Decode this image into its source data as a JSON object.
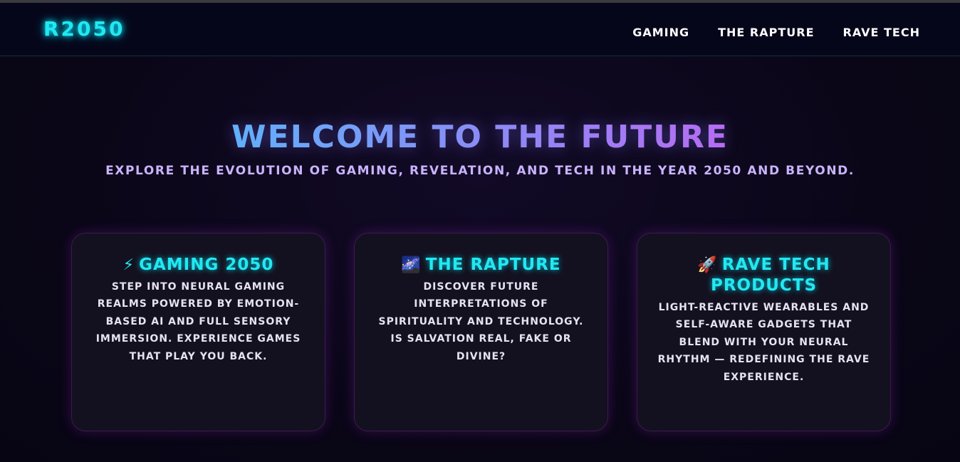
{
  "header": {
    "logo": "R2050",
    "nav": [
      {
        "label": "GAMING"
      },
      {
        "label": "THE RAPTURE"
      },
      {
        "label": "RAVE TECH"
      }
    ]
  },
  "hero": {
    "title": "WELCOME TO THE FUTURE",
    "subtitle": "EXPLORE THE EVOLUTION OF GAMING, REVELATION, AND TECH IN THE YEAR 2050 AND BEYOND."
  },
  "cards": [
    {
      "icon": "⚡",
      "icon_name": "lightning-icon",
      "title": "GAMING 2050",
      "body": "STEP INTO NEURAL GAMING REALMS POWERED BY EMOTION-BASED AI AND FULL SENSORY IMMERSION. EXPERIENCE GAMES THAT PLAY YOU BACK."
    },
    {
      "icon": "🌌",
      "icon_name": "galaxy-icon",
      "title": "THE RAPTURE",
      "body": "DISCOVER FUTURE INTERPRETATIONS OF SPIRITUALITY AND TECHNOLOGY. IS SALVATION REAL, FAKE OR DIVINE?"
    },
    {
      "icon": "🚀",
      "icon_name": "rocket-icon",
      "title": "RAVE TECH PRODUCTS",
      "body": "LIGHT-REACTIVE WEARABLES AND SELF-AWARE GADGETS THAT BLEND WITH YOUR NEURAL RHYTHM — REDEFINING THE RAVE EXPERIENCE."
    }
  ],
  "colors": {
    "accent_cyan": "#22e8f0",
    "accent_purple": "#c9b3ff",
    "gradient_start": "#3ad1ff",
    "gradient_end": "#e04ef0",
    "background": "#0a0617",
    "card_bg": "#13111f"
  }
}
